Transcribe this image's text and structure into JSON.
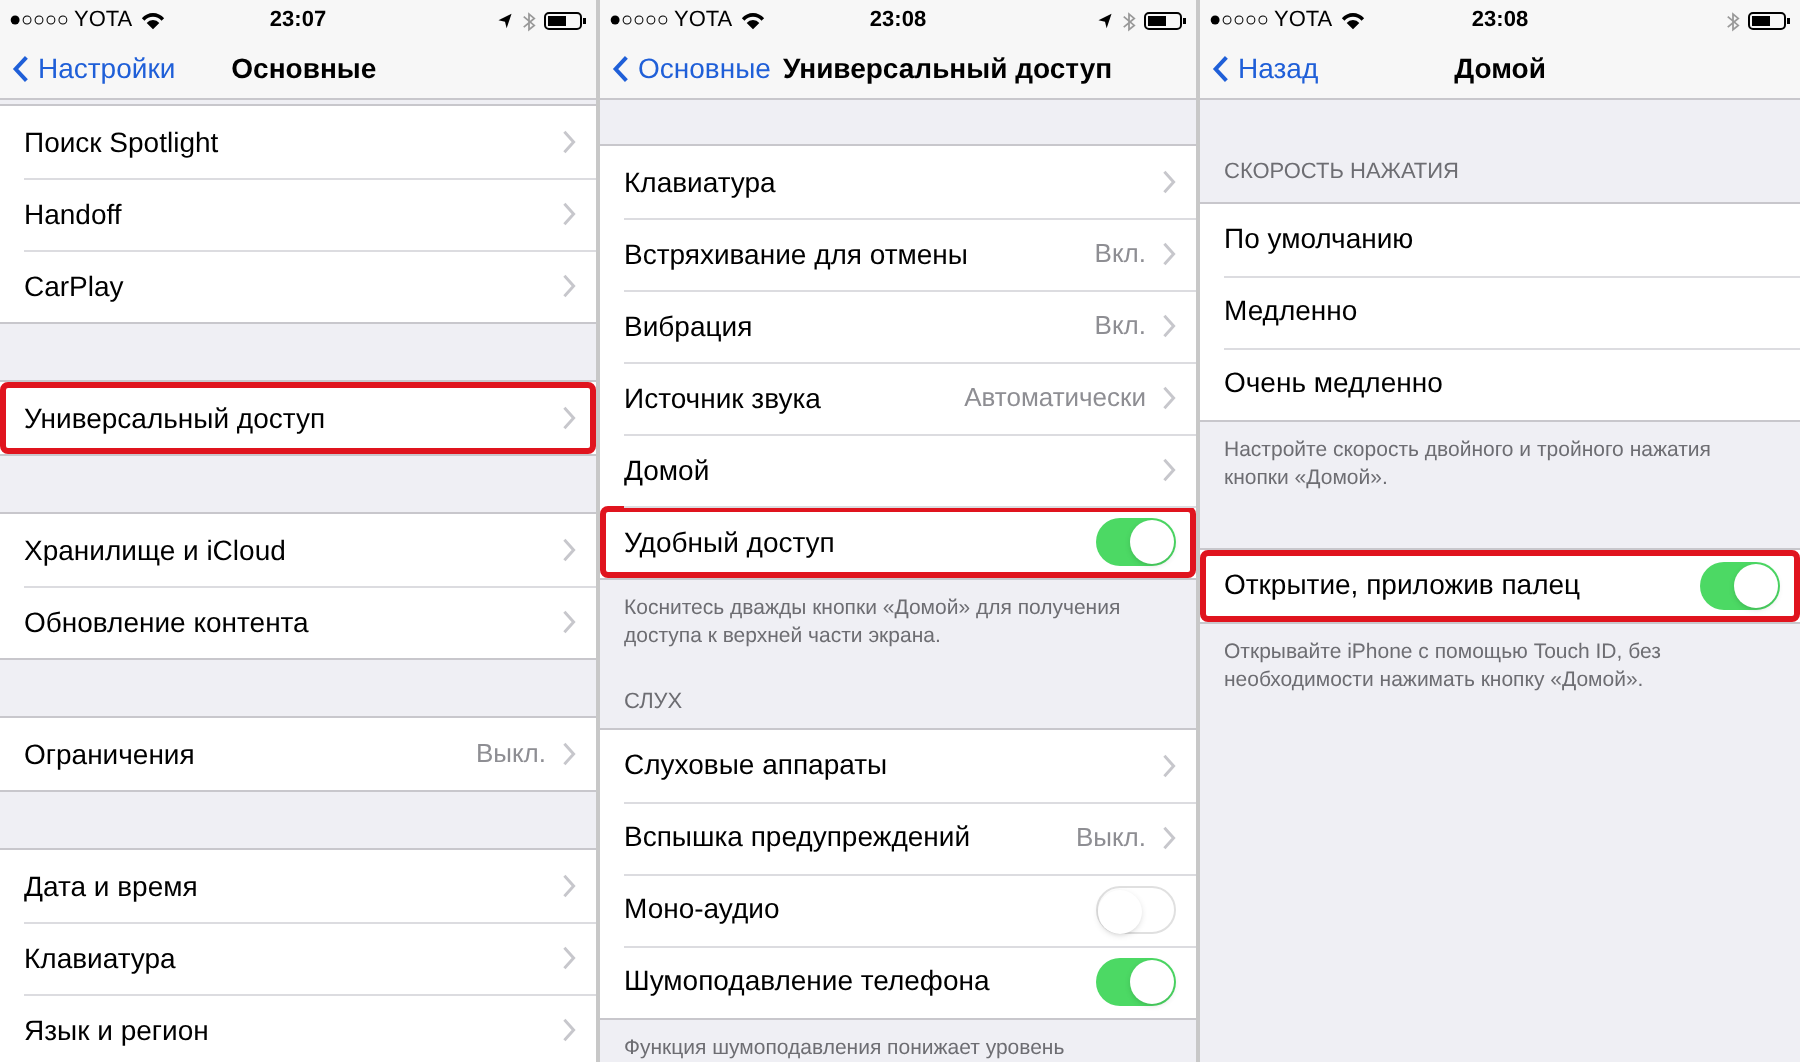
{
  "screens": [
    {
      "status_bar": {
        "carrier": "YOTA",
        "time": "23:07",
        "location": true
      },
      "nav": {
        "back": "Настройки",
        "title": "Основные"
      },
      "groups": [
        {
          "rows": [
            {
              "kind": "link",
              "label": "Поиск Spotlight",
              "highlighted": false
            },
            {
              "kind": "link",
              "label": "Handoff",
              "highlighted": false
            },
            {
              "kind": "link",
              "label": "CarPlay",
              "highlighted": false
            }
          ]
        },
        {
          "rows": [
            {
              "kind": "link",
              "label": "Универсальный доступ",
              "highlighted": true
            }
          ]
        },
        {
          "rows": [
            {
              "kind": "link",
              "label": "Хранилище и iCloud",
              "highlighted": false
            },
            {
              "kind": "link",
              "label": "Обновление контента",
              "highlighted": false
            }
          ]
        },
        {
          "rows": [
            {
              "kind": "link",
              "label": "Ограничения",
              "value": "Выкл.",
              "highlighted": false
            }
          ]
        },
        {
          "rows": [
            {
              "kind": "link",
              "label": "Дата и время",
              "highlighted": false
            },
            {
              "kind": "link",
              "label": "Клавиатура",
              "highlighted": false
            },
            {
              "kind": "link",
              "label": "Язык и регион",
              "highlighted": false
            }
          ]
        }
      ]
    },
    {
      "status_bar": {
        "carrier": "YOTA",
        "time": "23:08",
        "location": true
      },
      "nav": {
        "back": "Основные",
        "title": "Универсальный доступ"
      },
      "groups": [
        {
          "rows": [
            {
              "kind": "link",
              "label": "Клавиатура",
              "highlighted": false
            },
            {
              "kind": "link",
              "label": "Встряхивание для отмены",
              "value": "Вкл.",
              "highlighted": false
            },
            {
              "kind": "link",
              "label": "Вибрация",
              "value": "Вкл.",
              "highlighted": false
            },
            {
              "kind": "link",
              "label": "Источник звука",
              "value": "Автоматически",
              "highlighted": false
            },
            {
              "kind": "link",
              "label": "Домой",
              "highlighted": false
            },
            {
              "kind": "toggle",
              "label": "Удобный доступ",
              "on": true,
              "highlighted": true
            }
          ],
          "footer": "Коснитесь дважды кнопки «Домой» для получения доступа к верхней части экрана."
        },
        {
          "header": "СЛУХ",
          "rows": [
            {
              "kind": "link",
              "label": "Слуховые аппараты",
              "highlighted": false
            },
            {
              "kind": "link",
              "label": "Вспышка предупреждений",
              "value": "Выкл.",
              "highlighted": false
            },
            {
              "kind": "toggle",
              "label": "Моно-аудио",
              "on": false,
              "highlighted": false
            },
            {
              "kind": "toggle",
              "label": "Шумоподавление телефона",
              "on": true,
              "highlighted": false
            }
          ],
          "footer": "Функция шумоподавления понижает уровень"
        }
      ]
    },
    {
      "status_bar": {
        "carrier": "YOTA",
        "time": "23:08",
        "location": false
      },
      "nav": {
        "back": "Назад",
        "title": "Домой"
      },
      "groups": [
        {
          "header": "СКОРОСТЬ НАЖАТИЯ",
          "rows": [
            {
              "kind": "plain",
              "label": "По умолчанию",
              "highlighted": false
            },
            {
              "kind": "plain",
              "label": "Медленно",
              "highlighted": false
            },
            {
              "kind": "plain",
              "label": "Очень медленно",
              "highlighted": false
            }
          ],
          "footer": "Настройте скорость двойного и тройного нажатия кнопки «Домой»."
        },
        {
          "rows": [
            {
              "kind": "toggle",
              "label": "Открытие, приложив палец",
              "on": true,
              "highlighted": true
            }
          ],
          "footer": "Открывайте iPhone с помощью Touch ID, без необходимости нажимать кнопку «Домой»."
        }
      ]
    }
  ]
}
